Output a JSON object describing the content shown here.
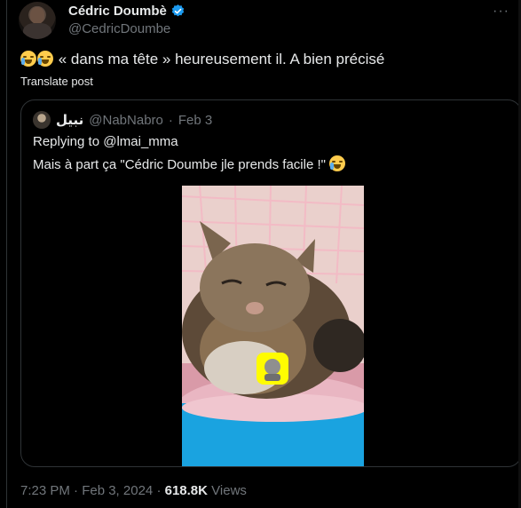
{
  "author": {
    "display_name": "Cédric Doumbè",
    "handle": "@CedricDoumbe"
  },
  "tweet": {
    "text": "« dans ma tête » heureusement il. A bien précisé",
    "translate_label": "Translate post"
  },
  "quoted": {
    "name": "نبيل",
    "handle": "@NabNabro",
    "separator": "·",
    "date": "Feb 3",
    "reply_label": "Replying to @lmai_mma",
    "text": "Mais à part ça \"Cédric Doumbe jle prends facile !\""
  },
  "footer": {
    "timestamp": "7:23 PM · Feb 3, 2024",
    "separator": "·",
    "views_count": "618.8K",
    "views_label": "Views"
  },
  "colors": {
    "background": "#000000",
    "text_primary": "#e7e9ea",
    "text_secondary": "#71767b",
    "border": "#2f3336",
    "verified": "#1d9bf0"
  },
  "icons": [
    "verified-badge-icon",
    "more-options-icon",
    "crying-laughing-emoji-icon",
    "snapchat-sticker-icon"
  ]
}
